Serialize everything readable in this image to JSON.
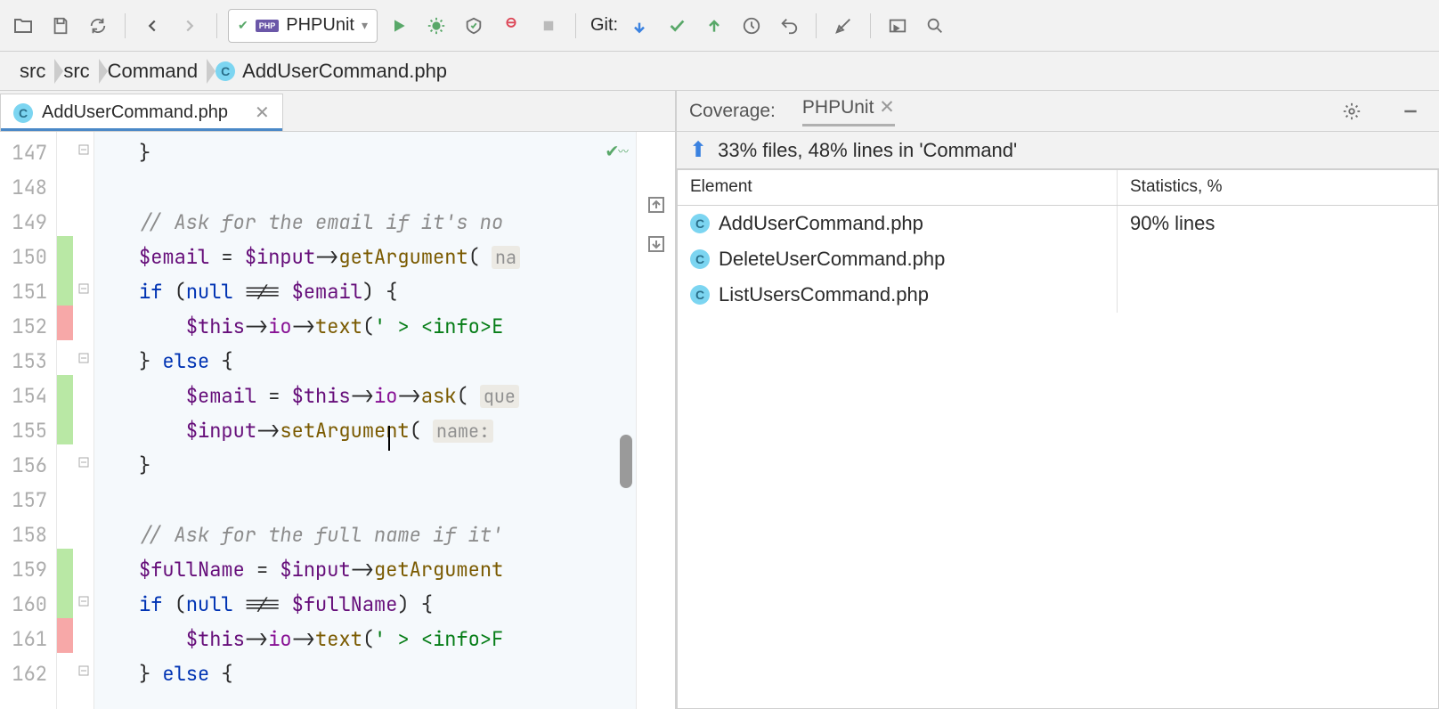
{
  "toolbar": {
    "run_config_label": "PHPUnit",
    "git_label": "Git:"
  },
  "breadcrumbs": [
    "src",
    "src",
    "Command",
    "AddUserCommand.php"
  ],
  "tab": {
    "label": "AddUserCommand.php"
  },
  "gutter_lines": [
    "147",
    "148",
    "149",
    "150",
    "151",
    "152",
    "153",
    "154",
    "155",
    "156",
    "157",
    "158",
    "159",
    "160",
    "161",
    "162"
  ],
  "code_lines": [
    {
      "html": "}"
    },
    {
      "html": ""
    },
    {
      "html": "<span class='cmt'>// Ask for the email if it's no</span>"
    },
    {
      "html": "<span class='var'>$email</span> = <span class='var'>$input</span>-><span class='fn'>getArgument</span>( <span class='hint'>na</span>"
    },
    {
      "html": "<span class='kw'>if</span> (<span class='kw'>null</span> !== <span class='var'>$email</span>) {"
    },
    {
      "html": "    <span class='var'>$this</span>-><span class='prop'>io</span>-><span class='fn'>text</span>(<span class='str'>' &gt; &lt;info&gt;E</span>"
    },
    {
      "html": "} <span class='kw'>else</span> {"
    },
    {
      "html": "    <span class='var'>$email</span> = <span class='var'>$this</span>-><span class='prop'>io</span>-><span class='fn'>ask</span>( <span class='hint'>que</span>"
    },
    {
      "html": "    <span class='var'>$input</span>-><span class='fn'>setArgument</span>( <span class='hint'>name:</span>"
    },
    {
      "html": "}"
    },
    {
      "html": ""
    },
    {
      "html": "<span class='cmt'>// Ask for the full name if it'</span>"
    },
    {
      "html": "<span class='var'>$fullName</span> = <span class='var'>$input</span>-><span class='fn'>getArgument</span>"
    },
    {
      "html": "<span class='kw'>if</span> (<span class='kw'>null</span> !== <span class='var'>$fullName</span>) {"
    },
    {
      "html": "    <span class='var'>$this</span>-><span class='prop'>io</span>-><span class='fn'>text</span>(<span class='str'>' &gt; &lt;info&gt;F</span>"
    },
    {
      "html": "} <span class='kw'>else</span> {"
    }
  ],
  "coverage_strip": [
    "",
    "",
    "",
    "green",
    "green",
    "red",
    "",
    "green",
    "green",
    "",
    "",
    "",
    "green",
    "green",
    "red",
    ""
  ],
  "coverage": {
    "title": "Coverage:",
    "suite": "PHPUnit",
    "summary": "33% files, 48% lines in 'Command'",
    "columns": {
      "element": "Element",
      "stats": "Statistics, %"
    },
    "rows": [
      {
        "name": "AddUserCommand.php",
        "stats": "90% lines"
      },
      {
        "name": "DeleteUserCommand.php",
        "stats": ""
      },
      {
        "name": "ListUsersCommand.php",
        "stats": ""
      }
    ]
  }
}
